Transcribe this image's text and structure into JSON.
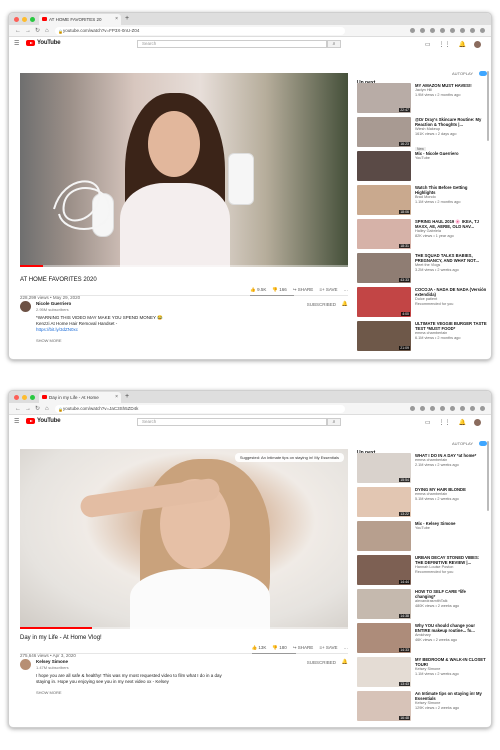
{
  "colors": {
    "accent": "#ff0000",
    "link": "#1a6bd8",
    "toggle": "#3ea6ff"
  },
  "shot1": {
    "tab_title": "AT HOME FAVORITES 20",
    "url": "youtube.com/watch?v=FP3X-0nU-Z04",
    "search_placeholder": "Search",
    "logo_text": "YouTube",
    "video": {
      "title": "AT HOME FAVORITES 2020",
      "views": "228,299 views • May 29, 2020",
      "progress": 0.07
    },
    "actions": {
      "like": "9.5K",
      "dislike": "166",
      "share": "SHARE",
      "save": "SAVE",
      "more": "…"
    },
    "channel": {
      "name": "Nicole Guerriero",
      "subs": "2.95M subscribers",
      "subscribe": "SUBSCRIBED"
    },
    "description": {
      "line1": "*WARNING THIS VIDEO MAY MAKE YOU SPEND MONEY 😂",
      "line2": "Kenzzi At Home Hair Removal Handset -",
      "link": "https://bit.ly/3dZN0xc",
      "show_more": "SHOW MORE"
    },
    "upnext": "Up next",
    "autoplay": "AUTOPLAY",
    "items": [
      {
        "title": "MY AMAZON MUST HAVES!!",
        "channel": "Jaclyn Hill",
        "views": "1.9M views • 2 months ago",
        "badge": "",
        "duration": "22:47",
        "thumb": "#b8aca6"
      },
      {
        "title": "@Dr Dray's Skincare Routine: My Reaction & Thoughts |...",
        "channel": "Wiesh Makeup",
        "views": "161K views • 2 days ago",
        "badge": "New",
        "duration": "16:23",
        "thumb": "#a89a92"
      },
      {
        "title": "Mix - Nicole Guerriero",
        "channel": "YouTube",
        "views": "",
        "badge": "",
        "duration": "",
        "thumb": "#5a4a46"
      },
      {
        "title": "Watch This Before Getting Highlights",
        "channel": "Brad Mondo",
        "views": "1.1M views • 2 months ago",
        "badge": "",
        "duration": "18:06",
        "thumb": "#c9a98e"
      },
      {
        "title": "SPRING HAUL 2019 🌸 IKEA, TJ MAXX, AE, AERIE, OLD NAV...",
        "channel": "Hailey Gabriela",
        "views": "82K views • 1 year ago",
        "badge": "",
        "duration": "18:31",
        "thumb": "#d6b2a8"
      },
      {
        "title": "THE SQUAD TALKS BABIES, PREGNANCY, AND WHAT NOT...",
        "channel": "Meet the Vlogs",
        "views": "3.2M views • 2 weeks ago",
        "badge": "",
        "duration": "43:33",
        "thumb": "#8f7d73"
      },
      {
        "title": "COCOJA - NADA DE NADA (Versión extendida)",
        "channel": "Dulce patient",
        "views": "Recommended for you",
        "badge": "",
        "duration": "4:00",
        "thumb": "#c24545"
      },
      {
        "title": "ULTIMATE VEGGIE BURGER TASTE TEST *MUST FOOD*",
        "channel": "emma chamberlain",
        "views": "6.1M views • 2 months ago",
        "badge": "",
        "duration": "21:09",
        "thumb": "#6e5849"
      }
    ]
  },
  "shot2": {
    "tab_title": "Day in my Life - At Home",
    "url": "youtube.com/watch?v=JaC3Sh5ZD4k",
    "search_placeholder": "Search",
    "logo_text": "YouTube",
    "promo": "Suggested: An Intimate tips on staying in! My Essentials",
    "video": {
      "title": "Day in my Life - At Home Vlog!",
      "views": "275,646 views • Apr 3, 2020",
      "progress": 0.22
    },
    "actions": {
      "like": "13K",
      "dislike": "180",
      "share": "SHARE",
      "save": "SAVE",
      "more": "…"
    },
    "channel": {
      "name": "Kelsey Simone",
      "subs": "1.47M subscribers",
      "subscribe": "SUBSCRIBED"
    },
    "description": {
      "line1": "I hope you are all safe & healthy! This was my most requested video to film what I do in a day",
      "line2": "staying in. Hope you enjoying see you in my next video xx - Kelsey",
      "link": "",
      "show_more": "SHOW MORE"
    },
    "upnext": "Up next",
    "autoplay": "AUTOPLAY",
    "items": [
      {
        "title": "WHAT I DO IN A DAY *at home*",
        "channel": "emma chamberlain",
        "views": "2.1M views • 2 weeks ago",
        "badge": "",
        "duration": "15:54",
        "thumb": "#d9d2cc"
      },
      {
        "title": "DYING MY HAIR BLONDE",
        "channel": "emma chamberlain",
        "views": "5.1M views • 2 weeks ago",
        "badge": "",
        "duration": "13:22",
        "thumb": "#e2c6b2"
      },
      {
        "title": "Mix - Kelsey Simone",
        "channel": "YouTube",
        "views": "",
        "badge": "",
        "duration": "",
        "thumb": "#b79f8e"
      },
      {
        "title": "URBAN DECAY STONED VIBES: THE DEFINITIVE REVIEW |...",
        "channel": "Hannah Louise Poston",
        "views": "Recommended for you",
        "badge": "",
        "duration": "14:44",
        "thumb": "#7d6053"
      },
      {
        "title": "HOW TO SELF CARE *life changing*",
        "channel": "alexandrasmithTalk",
        "views": "480K views • 2 weeks ago",
        "badge": "",
        "duration": "14:38",
        "thumb": "#c5b9ae"
      },
      {
        "title": "Why YOU should change your ENTIRE makeup routine... fo...",
        "channel": "Amichary",
        "views": "46K views • 2 weeks ago",
        "badge": "",
        "duration": "14:33",
        "thumb": "#ad8c7a"
      },
      {
        "title": "MY BEDROOM & WALK-IN CLOSET TOUR!",
        "channel": "Kelsey Simone",
        "views": "1.1M views • 2 weeks ago",
        "badge": "",
        "duration": "13:43",
        "thumb": "#e4dcd4"
      },
      {
        "title": "An Intimate tips on staying in! My Essentials",
        "channel": "Kelsey Simone",
        "views": "129K views • 2 weeks ago",
        "badge": "",
        "duration": "16:48",
        "thumb": "#d7c3b8"
      }
    ]
  }
}
